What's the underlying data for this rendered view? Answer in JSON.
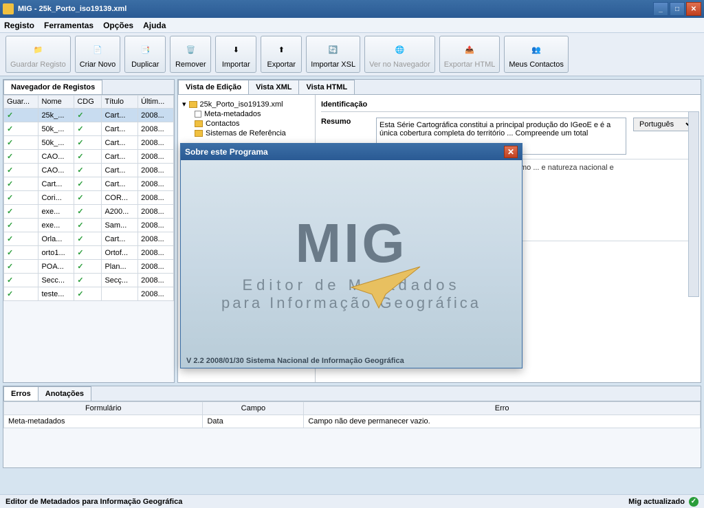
{
  "window": {
    "title": "MIG - 25k_Porto_iso19139.xml"
  },
  "menu": [
    "Registo",
    "Ferramentas",
    "Opções",
    "Ajuda"
  ],
  "toolbar": [
    {
      "label": "Guardar Registo",
      "icon": "folder-open-icon",
      "disabled": true
    },
    {
      "label": "Criar Novo",
      "icon": "file-new-icon"
    },
    {
      "label": "Duplicar",
      "icon": "files-icon"
    },
    {
      "label": "Remover",
      "icon": "trash-icon"
    },
    {
      "label": "Importar",
      "icon": "import-icon"
    },
    {
      "label": "Exportar",
      "icon": "export-icon"
    },
    {
      "label": "Importar XSL",
      "icon": "xsl-icon"
    },
    {
      "label": "Ver no Navegador",
      "icon": "globe-icon",
      "disabled": true
    },
    {
      "label": "Exportar HTML",
      "icon": "html-icon",
      "disabled": true
    },
    {
      "label": "Meus Contactos",
      "icon": "people-icon"
    }
  ],
  "nav_tab": "Navegador de Registos",
  "record_columns": [
    "Guar...",
    "Nome",
    "CDG",
    "Título",
    "Últim..."
  ],
  "records": [
    {
      "nome": "25k_...",
      "titulo": "Cart...",
      "data": "2008...",
      "sel": true
    },
    {
      "nome": "50k_...",
      "titulo": "Cart...",
      "data": "2008..."
    },
    {
      "nome": "50k_...",
      "titulo": "Cart...",
      "data": "2008..."
    },
    {
      "nome": "CAO...",
      "titulo": "Cart...",
      "data": "2008..."
    },
    {
      "nome": "CAO...",
      "titulo": "Cart...",
      "data": "2008..."
    },
    {
      "nome": "Cart...",
      "titulo": "Cart...",
      "data": "2008..."
    },
    {
      "nome": "Cori...",
      "titulo": "COR...",
      "data": "2008..."
    },
    {
      "nome": "exe...",
      "titulo": "A200...",
      "data": "2008..."
    },
    {
      "nome": "exe...",
      "titulo": "Sam...",
      "data": "2008..."
    },
    {
      "nome": "Orla...",
      "titulo": "Cart...",
      "data": "2008..."
    },
    {
      "nome": "orto1...",
      "titulo": "Ortof...",
      "data": "2008..."
    },
    {
      "nome": "POA...",
      "titulo": "Plan...",
      "data": "2008..."
    },
    {
      "nome": "Secc...",
      "titulo": "Secç...",
      "data": "2008..."
    },
    {
      "nome": "teste...",
      "titulo": "",
      "data": "2008..."
    }
  ],
  "view_tabs": [
    "Vista de Edição",
    "Vista XML",
    "Vista HTML"
  ],
  "tree": {
    "root": "25k_Porto_iso19139.xml",
    "children": [
      "Meta-metadados",
      "Contactos",
      "Sistemas de Referência"
    ]
  },
  "form": {
    "section": "Identificação",
    "resumo_label": "Resumo",
    "resumo_text": "Esta Série Cartográfica constitui a principal produção do IGeoE e é a única cobertura completa do território ... Compreende um total",
    "lang_value": "Português",
    "extra_text": "...tremamente rica em ... té hoje usada como ... e natureza nacional e"
  },
  "bottom_tabs": [
    "Erros",
    "Anotações"
  ],
  "errors_columns": [
    "Formulário",
    "Campo",
    "Erro"
  ],
  "errors_rows": [
    {
      "form": "Meta-metadados",
      "campo": "Data",
      "erro": "Campo não deve permanecer vazio."
    }
  ],
  "status": {
    "left": "Editor de Metadados para Informação Geográfica",
    "right": "Mig actualizado"
  },
  "about": {
    "title": "Sobre este Programa",
    "logo": "MIG",
    "line1": "Editor de Metadados",
    "line2": "para Informação Geográfica",
    "version": "V 2.2 2008/01/30  Sistema Nacional de Informação Geográfica"
  }
}
